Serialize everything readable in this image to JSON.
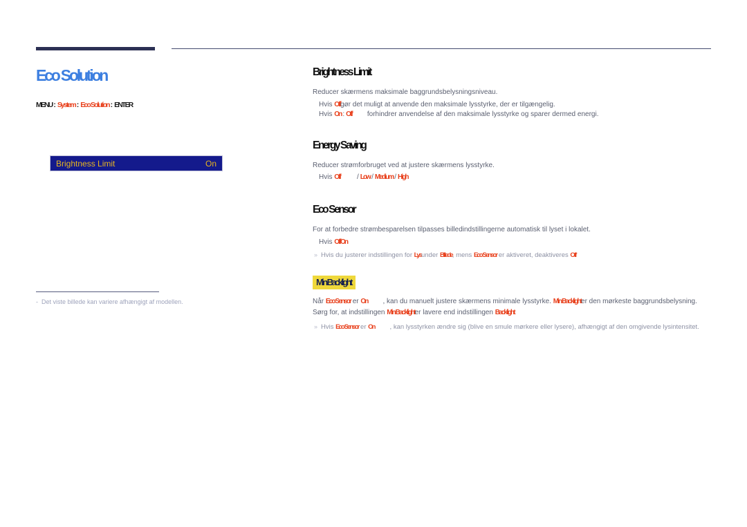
{
  "page": {
    "language": "da",
    "title": "Eco Solution",
    "title_color": "#3d7fe0",
    "accent_red": "#e8401c",
    "highlight_yellow": "#efd83b",
    "rule_navy": "#2c3054"
  },
  "breadcrumb": {
    "menu": "MENU",
    "sep": ":",
    "level1": "System",
    "level2": "Eco Solution",
    "enter": "ENTER"
  },
  "osd": {
    "label": "Brightness Limit",
    "value": "On",
    "bg_color": "#141a8c",
    "text_color": "#e8b520"
  },
  "left_note": {
    "dash": "-",
    "text": "Det viste billede kan variere afhængigt af modellen."
  },
  "sections": [
    {
      "heading": "Brightness Limit",
      "body": "Reducer skærmens maksimale baggrundsbelysningsniveau.",
      "options": [
        {
          "lead": "Hvis",
          "keyword": "Off",
          "tail": "gør det muligt at anvende den maksimale lysstyrke, der er tilgængelig."
        },
        {
          "lead": "Hvis",
          "keyword": "On",
          "keyword2": "Off",
          "tail": "forhindrer anvendelse af den maksimale lysstyrke og sparer dermed energi."
        }
      ]
    },
    {
      "heading": "Energy Saving",
      "body": "Reducer strømforbruget ved at justere skærmens lysstyrke.",
      "options": [
        {
          "lead": "Hvis",
          "choices": [
            "Off",
            "Low",
            "Medium",
            "High"
          ],
          "separator": "/"
        }
      ]
    },
    {
      "heading": "Eco Sensor",
      "body": "For at forbedre strømbesparelsen tilpasses billedindstillingerne automatisk til lyset i lokalet.",
      "options": [
        {
          "lead": "Hvis",
          "choices": [
            "Off",
            "On"
          ]
        }
      ],
      "notes": [
        {
          "bullet": "»",
          "pre": "Hvis du justerer indstillingen for",
          "kw1": "Lys",
          "mid1": "under",
          "kw2": "Billede",
          "mid2": ", mens",
          "kw3": "Eco Sensor",
          "mid3": "er aktiveret, deaktiveres",
          "kw4": "Off"
        }
      ]
    },
    {
      "heading": "Min Backlight",
      "highlighted": true,
      "paragraph": {
        "pre": "Når",
        "kw1": "Eco Sensor",
        "mid1": "er",
        "kw2": "On",
        "mid2": ", kan du manuelt justere skærmens minimale lysstyrke.",
        "kw3": "Min Backlight",
        "mid3": "er den mørkeste baggrundsbelysning. Sørg for, at indstillingen",
        "kw4": "Min Backlight",
        "mid4": "er lavere end indstillingen",
        "kw5": "Backlight"
      },
      "notes": [
        {
          "bullet": "»",
          "pre": "Hvis",
          "kw1": "Eco Sensor",
          "mid1": "er",
          "kw2": "On",
          "tail": ", kan lysstyrken ændre sig (blive en smule mørkere eller lysere), afhængigt af den omgivende lysintensitet."
        }
      ]
    }
  ]
}
